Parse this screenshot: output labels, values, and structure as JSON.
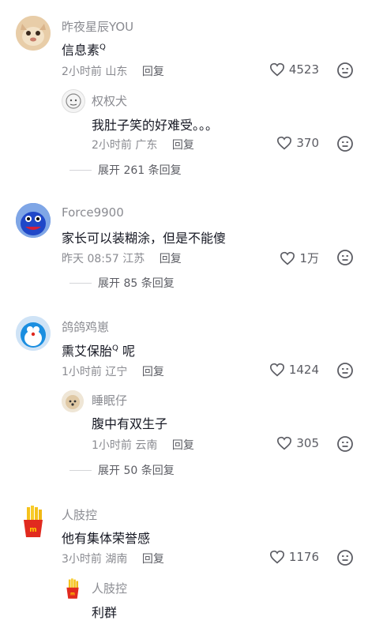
{
  "comments": [
    {
      "username": "昨夜星辰YOU",
      "text": "信息素",
      "text_suffix": "",
      "time": "2小时前",
      "location": "山东",
      "reply_label": "回复",
      "likes": "4523"
    },
    {
      "username": "权权犬",
      "text": "我肚子笑的好难受。。。",
      "time": "2小时前",
      "location": "广东",
      "reply_label": "回复",
      "likes": "370",
      "expand_label": "展开 261 条回复"
    },
    {
      "username": "Force9900",
      "text": "家长可以装糊涂，但是不能傻",
      "time": "昨天 08:57",
      "location": "江苏",
      "reply_label": "回复",
      "likes": "1万",
      "expand_label": "展开 85 条回复"
    },
    {
      "username": "鸽鸽鸡崽",
      "text": "熏艾保胎",
      "text_suffix": "呢",
      "time": "1小时前",
      "location": "辽宁",
      "reply_label": "回复",
      "likes": "1424"
    },
    {
      "username": "睡眠仔",
      "text": "腹中有双生子",
      "time": "1小时前",
      "location": "云南",
      "reply_label": "回复",
      "likes": "305",
      "expand_label": "展开 50 条回复"
    },
    {
      "username": "人肢控",
      "text": "他有集体荣誉感",
      "time": "3小时前",
      "location": "湖南",
      "reply_label": "回复",
      "likes": "1176"
    },
    {
      "username": "人肢控",
      "text": "利群"
    }
  ],
  "search_mark": "Q"
}
